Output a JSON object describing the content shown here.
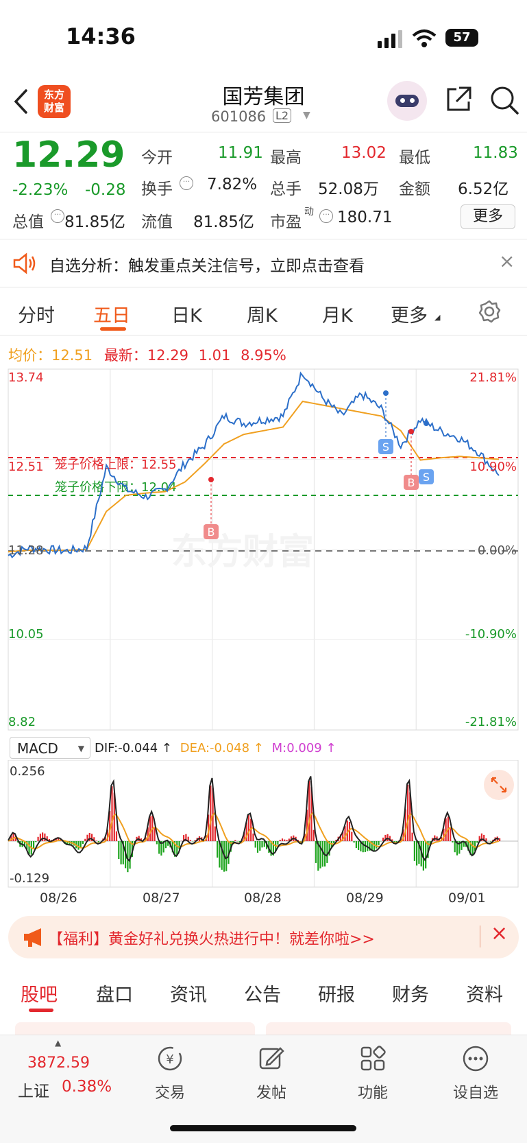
{
  "status_bar": {
    "time": "14:36",
    "battery": "57"
  },
  "header": {
    "title": "国芳集团",
    "code": "601086",
    "level": "L2",
    "logo_text": "东方\n财富"
  },
  "quote": {
    "price": "12.29",
    "change_pct": "-2.23%",
    "change": "-0.28",
    "fields": [
      {
        "label": "今开",
        "value": "11.91",
        "color": "green"
      },
      {
        "label": "最高",
        "value": "13.02",
        "color": "red"
      },
      {
        "label": "最低",
        "value": "11.83",
        "color": "green"
      },
      {
        "label": "换手",
        "value": "7.82%",
        "color": "dark"
      },
      {
        "label": "总手",
        "value": "52.08万",
        "color": "dark"
      },
      {
        "label": "金额",
        "value": "6.52亿",
        "color": "dark"
      },
      {
        "label": "总值",
        "value": "81.85亿",
        "color": "dark"
      },
      {
        "label": "流值",
        "value": "81.85亿",
        "color": "dark"
      },
      {
        "label": "市盈",
        "superscript": "动",
        "value": "180.71",
        "color": "dark"
      }
    ],
    "more_button": "更多"
  },
  "notice": {
    "text": "自选分析：触发重点关注信号，立即点击查看"
  },
  "chart_tabs": [
    "分时",
    "五日",
    "日K",
    "周K",
    "月K",
    "更多"
  ],
  "active_tab": "五日",
  "legend": {
    "avg_label": "均价：",
    "avg_value": "12.51",
    "latest_label": "最新：",
    "latest_value": "12.29",
    "latest_change": "1.01",
    "latest_pct": "8.95%"
  },
  "price_chart": {
    "left_ticks": [
      "13.74",
      "12.51",
      "11.28",
      "10.05",
      "8.82"
    ],
    "right_ticks": [
      "21.81%",
      "10.90%",
      "0.00%",
      "-10.90%",
      "-21.81%"
    ],
    "cage_upper": "笼子价格上限：12.55",
    "cage_lower": "笼子价格下限：12.04",
    "markers": [
      "B",
      "S",
      "B",
      "S"
    ],
    "watermark": "东方财富"
  },
  "chart_data": {
    "type": "line",
    "title": "",
    "x_categories": [
      "08/26",
      "08/27",
      "08/28",
      "08/29",
      "09/01"
    ],
    "ylim": [
      8.82,
      13.74
    ],
    "prev_close": 11.28,
    "series": [
      {
        "name": "price",
        "values": [
          11.2,
          11.3,
          11.28,
          11.26,
          11.3,
          12.4,
          12.1,
          12.0,
          12.1,
          12.45,
          12.7,
          13.1,
          13.0,
          13.05,
          13.1,
          13.7,
          13.35,
          13.1,
          13.4,
          13.2,
          12.7,
          13.05,
          12.9,
          12.8,
          12.6,
          12.29
        ]
      },
      {
        "name": "avg",
        "values": [
          11.25,
          11.27,
          11.27,
          11.27,
          11.28,
          11.8,
          12.02,
          12.05,
          12.07,
          12.2,
          12.45,
          12.72,
          12.85,
          12.9,
          12.95,
          13.3,
          13.25,
          13.2,
          13.15,
          13.1,
          12.9,
          12.5,
          12.53,
          12.55,
          12.53,
          12.51
        ]
      }
    ]
  },
  "macd": {
    "selector": "MACD",
    "dif": "DIF:-0.044 ↑",
    "dea": "DEA:-0.048 ↑",
    "m": "M:0.009 ↑",
    "y_top": "0.256",
    "y_bottom": "-0.129",
    "x_labels": [
      "08/26",
      "08/27",
      "08/28",
      "08/29",
      "09/01"
    ]
  },
  "banner": {
    "text": "【福利】黄金好礼兑换火热进行中！就差你啦>>"
  },
  "bottom_tabs": [
    "股吧",
    "盘口",
    "资讯",
    "公告",
    "研报",
    "财务",
    "资料"
  ],
  "bottom_nav": {
    "index_value": "3872.59",
    "index_name": "上证",
    "index_pct": "0.38%",
    "items": [
      {
        "label": "交易",
        "icon": "yen-exchange-icon"
      },
      {
        "label": "发帖",
        "icon": "edit-icon"
      },
      {
        "label": "功能",
        "icon": "grid-icon"
      },
      {
        "label": "设自选",
        "icon": "more-dots-icon"
      }
    ]
  }
}
